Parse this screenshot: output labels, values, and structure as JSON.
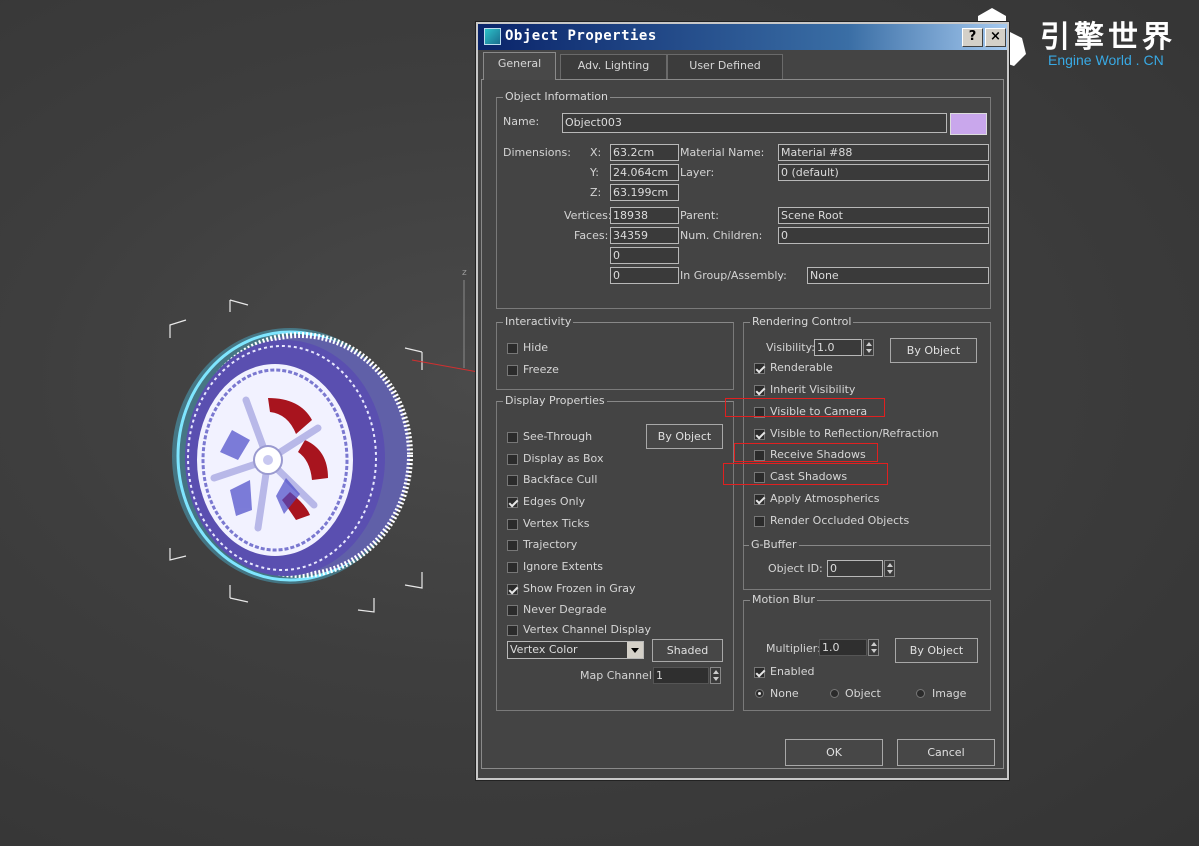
{
  "logo": {
    "title": "引擎世界",
    "subtitle": "Engine World . CN"
  },
  "viewport": {
    "axis_label": "z"
  },
  "dialog": {
    "title": "Object Properties",
    "help_glyph": "?",
    "close_glyph": "×",
    "tabs": [
      {
        "label": "General",
        "active": true
      },
      {
        "label": "Adv. Lighting",
        "active": false
      },
      {
        "label": "User Defined",
        "active": false
      }
    ],
    "object_info": {
      "group_title": "Object Information",
      "name_label": "Name:",
      "name_value": "Object003",
      "color_swatch": "#c9a7ec",
      "dimensions_label": "Dimensions:",
      "x_label": "X:",
      "x_value": "63.2cm",
      "y_label": "Y:",
      "y_value": "24.064cm",
      "z_label": "Z:",
      "z_value": "63.199cm",
      "vertices_label": "Vertices:",
      "vertices_value": "18938",
      "faces_label": "Faces:",
      "faces_value": "34359",
      "extra1_value": "0",
      "extra2_value": "0",
      "material_label": "Material Name:",
      "material_value": "Material #88",
      "layer_label": "Layer:",
      "layer_value": "0 (default)",
      "parent_label": "Parent:",
      "parent_value": "Scene Root",
      "children_label": "Num. Children:",
      "children_value": "0",
      "group_label": "In Group/Assembly:",
      "group_value": "None"
    },
    "interactivity": {
      "group_title": "Interactivity",
      "items": [
        {
          "label": "Hide",
          "checked": false
        },
        {
          "label": "Freeze",
          "checked": false
        }
      ]
    },
    "display": {
      "group_title": "Display Properties",
      "by_object": "By Object",
      "items": [
        {
          "label": "See-Through",
          "checked": false
        },
        {
          "label": "Display as Box",
          "checked": false
        },
        {
          "label": "Backface Cull",
          "checked": false
        },
        {
          "label": "Edges Only",
          "checked": true
        },
        {
          "label": "Vertex Ticks",
          "checked": false
        },
        {
          "label": "Trajectory",
          "checked": false
        },
        {
          "label": "Ignore Extents",
          "checked": false
        },
        {
          "label": "Show Frozen in Gray",
          "checked": true
        },
        {
          "label": "Never Degrade",
          "checked": false
        },
        {
          "label": "Vertex Channel Display",
          "checked": false
        }
      ],
      "channel_select": "Vertex Color",
      "shaded_label": "Shaded",
      "map_channel_label": "Map Channel:",
      "map_channel_value": "1"
    },
    "rendering": {
      "group_title": "Rendering Control",
      "visibility_label": "Visibility:",
      "visibility_value": "1.0",
      "by_object": "By Object",
      "items": [
        {
          "label": "Renderable",
          "checked": true
        },
        {
          "label": "Inherit Visibility",
          "checked": true
        },
        {
          "label": "Visible to Camera",
          "checked": false
        },
        {
          "label": "Visible to Reflection/Refraction",
          "checked": true
        },
        {
          "label": "Receive Shadows",
          "checked": false
        },
        {
          "label": "Cast Shadows",
          "checked": false
        },
        {
          "label": "Apply Atmospherics",
          "checked": true
        },
        {
          "label": "Render Occluded Objects",
          "checked": false
        }
      ],
      "highlight_color": "#e02020"
    },
    "gbuffer": {
      "group_title": "G-Buffer",
      "object_id_label": "Object ID:",
      "object_id_value": "0"
    },
    "motion_blur": {
      "group_title": "Motion Blur",
      "multiplier_label": "Multiplier:",
      "multiplier_value": "1.0",
      "by_object": "By Object",
      "enabled_label": "Enabled",
      "enabled_checked": true,
      "radios": [
        {
          "label": "None",
          "selected": true
        },
        {
          "label": "Object",
          "selected": false
        },
        {
          "label": "Image",
          "selected": false
        }
      ]
    },
    "ok_label": "OK",
    "cancel_label": "Cancel"
  }
}
